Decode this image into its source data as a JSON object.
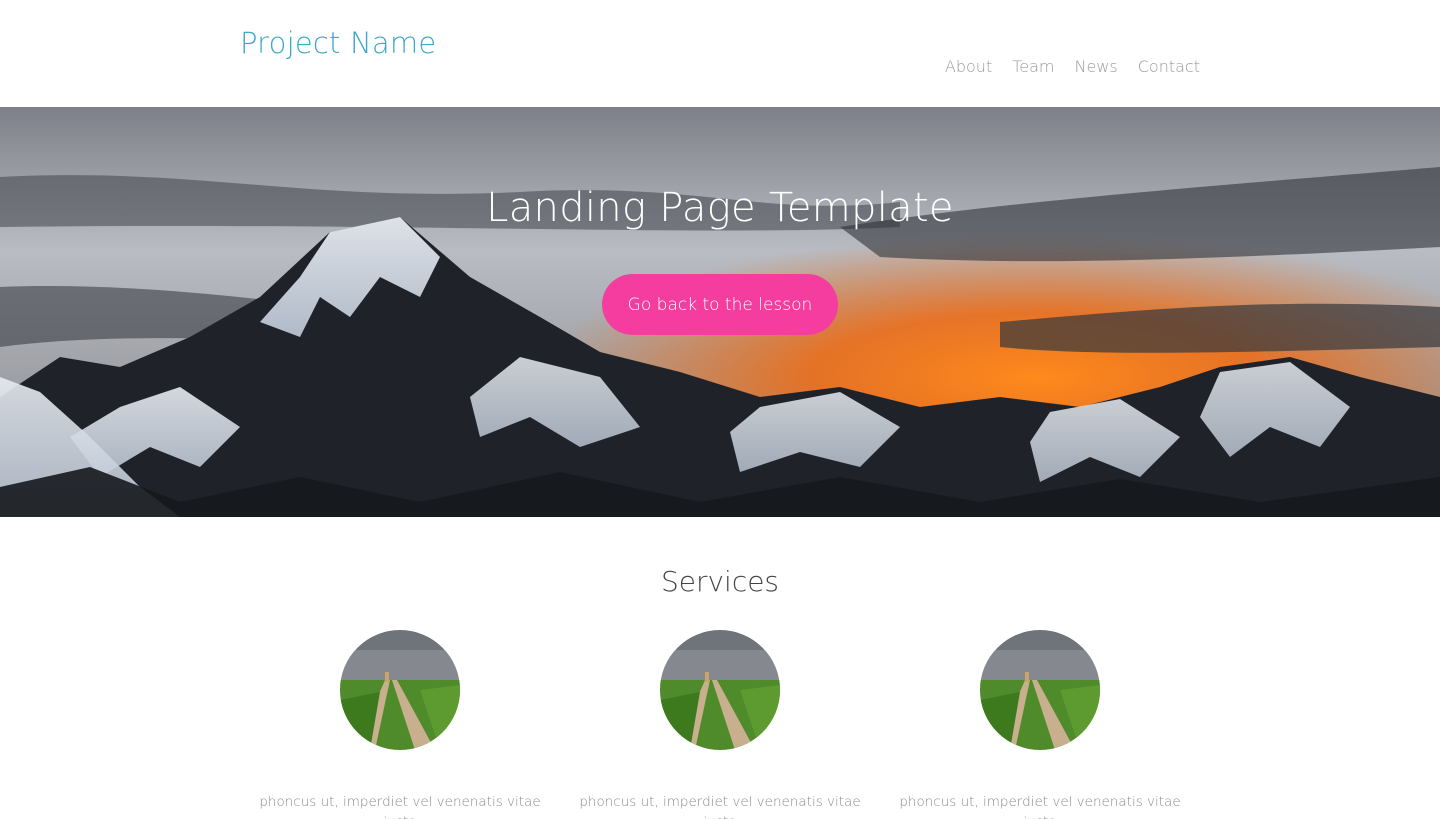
{
  "header": {
    "brand": "Project Name",
    "nav": [
      "About",
      "Team",
      "News",
      "Contact"
    ]
  },
  "hero": {
    "title": "Landing Page Template",
    "button_label": "Go back to the lesson",
    "image": "mountain-sunset-image"
  },
  "services": {
    "title": "Services",
    "items": [
      {
        "image": "path-through-field-image",
        "text": "phoncus ut, imperdiet vel venenatis vitae justo"
      },
      {
        "image": "path-through-field-image",
        "text": "phoncus ut, imperdiet vel venenatis vitae justo"
      },
      {
        "image": "path-through-field-image",
        "text": "phoncus ut, imperdiet vel venenatis vitae justo"
      }
    ]
  },
  "colors": {
    "brand": "#3fa7c9",
    "button": "#f43d9f",
    "nav_text": "#9a9a9a"
  }
}
